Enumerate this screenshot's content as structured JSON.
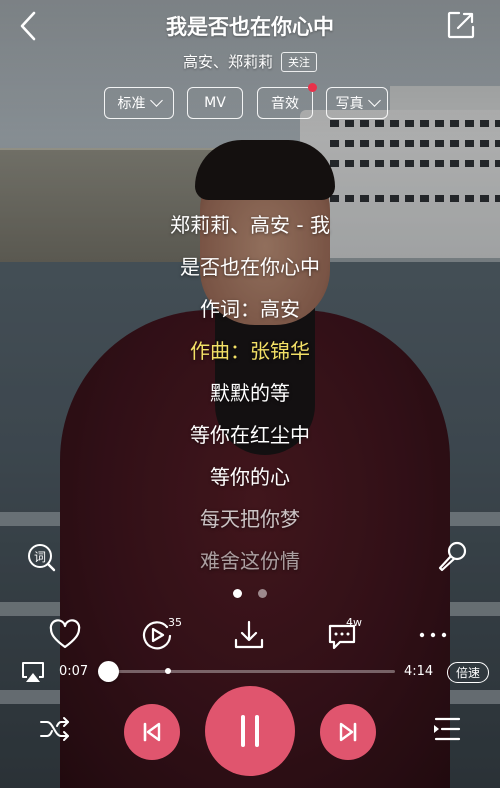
{
  "header": {
    "title": "我是否也在你心中",
    "artist": "高安、郑莉莉",
    "follow_label": "关注"
  },
  "pills": [
    {
      "label": "标准",
      "has_dropdown": true
    },
    {
      "label": "MV",
      "has_dropdown": false
    },
    {
      "label": "音效",
      "has_dropdown": false,
      "notification_dot": true
    },
    {
      "label": "写真",
      "has_dropdown": true
    }
  ],
  "lyrics": [
    {
      "text": "郑莉莉、高安 - 我",
      "state": "normal"
    },
    {
      "text": "是否也在你心中",
      "state": "normal"
    },
    {
      "text": "作词：高安",
      "state": "normal"
    },
    {
      "text": "作曲：张锦华",
      "state": "current"
    },
    {
      "text": "默默的等",
      "state": "normal"
    },
    {
      "text": "等你在红尘中",
      "state": "normal"
    },
    {
      "text": "等你的心",
      "state": "normal"
    },
    {
      "text": "每天把你梦",
      "state": "fading"
    },
    {
      "text": "难舍这份情",
      "state": "fading"
    }
  ],
  "lyric_button": {
    "label": "词"
  },
  "pager": {
    "count": 2,
    "active_index": 0
  },
  "actions": {
    "favorite": {
      "icon": "heart-icon"
    },
    "playlist": {
      "icon": "playlist-play-icon",
      "count": "35"
    },
    "download": {
      "icon": "download-icon"
    },
    "comments": {
      "icon": "comment-icon",
      "count": "4w"
    },
    "more": {
      "icon": "more-icon"
    }
  },
  "progress": {
    "current_time": "0:07",
    "total_time": "4:14",
    "played_fraction": 0.028,
    "buffered_fraction": 0.23,
    "speed_label": "倍速"
  },
  "controls": {
    "shuffle_icon": "shuffle-icon",
    "prev_icon": "skip-previous-icon",
    "pause_icon": "pause-icon",
    "next_icon": "skip-next-icon",
    "queue_icon": "queue-list-icon"
  },
  "colors": {
    "accent": "#e0556e",
    "current_lyric": "#f3e066",
    "notification": "#e8314a"
  }
}
